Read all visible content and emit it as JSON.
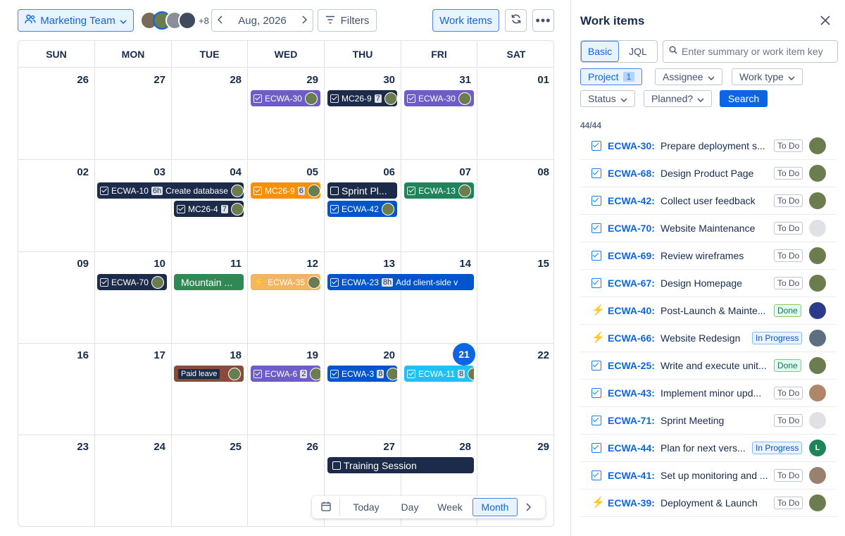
{
  "toolbar": {
    "team_label": "Marketing Team",
    "avatar_more": "+8",
    "month_label": "Aug, 2026",
    "filters_label": "Filters",
    "work_items_label": "Work items"
  },
  "calendar": {
    "days_of_week": [
      "SUN",
      "MON",
      "TUE",
      "WED",
      "THU",
      "FRI",
      "SAT"
    ],
    "weeks": [
      [
        "26",
        "27",
        "28",
        "29",
        "30",
        "31",
        "01"
      ],
      [
        "02",
        "03",
        "04",
        "05",
        "06",
        "07",
        "08"
      ],
      [
        "09",
        "10",
        "11",
        "12",
        "13",
        "14",
        "15"
      ],
      [
        "16",
        "17",
        "18",
        "19",
        "20",
        "21",
        "22"
      ],
      [
        "23",
        "24",
        "25",
        "26",
        "27",
        "28",
        "29"
      ]
    ],
    "today": "21",
    "events": {
      "w0_wed": "ECWA-30",
      "w0_thu": "MC26-9",
      "w0_thu_badge": "7",
      "w0_fri": "ECWA-30",
      "w1_mon": "ECWA-10",
      "w1_mon_badge": "6h",
      "w1_mon_title": "Create database",
      "w1_tue": "MC26-4",
      "w1_tue_badge": "7",
      "w1_wed": "MC26-9",
      "w1_wed_badge": "6",
      "w1_thu_a": "Sprint Pl...",
      "w1_thu_b": "ECWA-42",
      "w1_fri": "ECWA-13",
      "w2_mon": "ECWA-70",
      "w2_tue": "Mountain ...",
      "w2_wed": "ECWA-35",
      "w2_thu": "ECWA-23",
      "w2_thu_badge": "8h",
      "w2_thu_title": "Add client-side v",
      "w3_tue": "Paid leave",
      "w3_wed": "ECWA-6",
      "w3_wed_badge": "2",
      "w3_thu": "ECWA-3",
      "w3_thu_badge": "8",
      "w3_fri": "ECWA-11",
      "w3_fri_badge": "8",
      "w4_thu": "Training Session"
    }
  },
  "views": {
    "today": "Today",
    "day": "Day",
    "week": "Week",
    "month": "Month",
    "active": "Month"
  },
  "panel": {
    "title": "Work items",
    "basic": "Basic",
    "jql": "JQL",
    "search_placeholder": "Enter summary or work item key",
    "project": "Project",
    "project_count": "1",
    "assignee": "Assignee",
    "work_type": "Work type",
    "status": "Status",
    "planned": "Planned?",
    "search_button": "Search",
    "count": "44/44",
    "items": [
      {
        "key": "ECWA-30:",
        "summary": "Prepare deployment s...",
        "status": "To Do",
        "type": "task"
      },
      {
        "key": "ECWA-68:",
        "summary": "Design Product Page",
        "status": "To Do",
        "type": "task"
      },
      {
        "key": "ECWA-42:",
        "summary": "Collect user feedback",
        "status": "To Do",
        "type": "task"
      },
      {
        "key": "ECWA-70:",
        "summary": "Website Maintenance",
        "status": "To Do",
        "type": "task"
      },
      {
        "key": "ECWA-69:",
        "summary": "Review wireframes",
        "status": "To Do",
        "type": "task"
      },
      {
        "key": "ECWA-67:",
        "summary": "Design Homepage",
        "status": "To Do",
        "type": "task"
      },
      {
        "key": "ECWA-40:",
        "summary": "Post-Launch & Mainte...",
        "status": "Done",
        "type": "epic"
      },
      {
        "key": "ECWA-66:",
        "summary": "Website Redesign",
        "status": "In Progress",
        "type": "epic"
      },
      {
        "key": "ECWA-25:",
        "summary": "Write and execute unit...",
        "status": "Done",
        "type": "task"
      },
      {
        "key": "ECWA-43:",
        "summary": "Implement minor upd...",
        "status": "To Do",
        "type": "task"
      },
      {
        "key": "ECWA-71:",
        "summary": "Sprint Meeting",
        "status": "To Do",
        "type": "task"
      },
      {
        "key": "ECWA-44:",
        "summary": "Plan for next vers...",
        "status": "In Progress",
        "type": "task",
        "avatar": "L"
      },
      {
        "key": "ECWA-41:",
        "summary": "Set up monitoring and ...",
        "status": "To Do",
        "type": "task"
      },
      {
        "key": "ECWA-39:",
        "summary": "Deployment & Launch",
        "status": "To Do",
        "type": "epic"
      }
    ]
  }
}
